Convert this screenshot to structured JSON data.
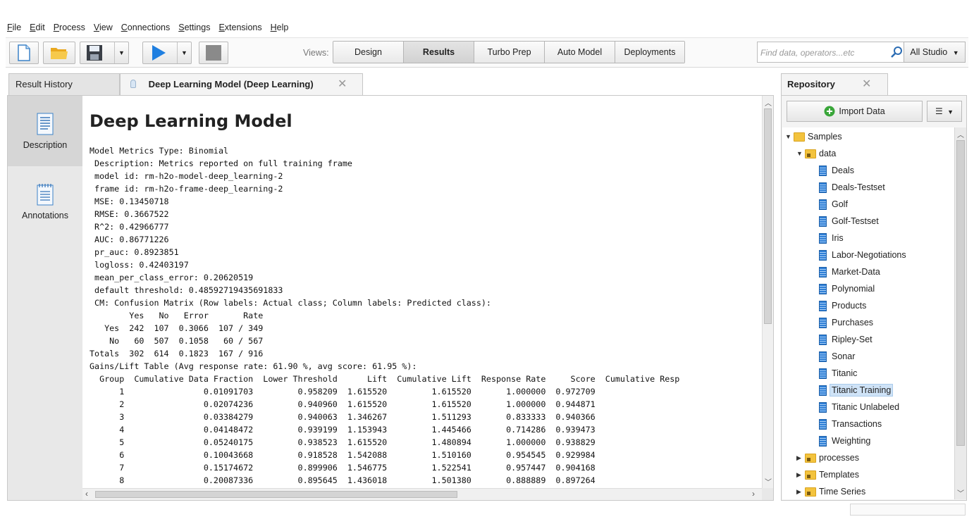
{
  "menu": [
    "File",
    "Edit",
    "Process",
    "View",
    "Connections",
    "Settings",
    "Extensions",
    "Help"
  ],
  "toolbar": {
    "views_label": "Views:",
    "views": [
      {
        "label": "Design",
        "active": false
      },
      {
        "label": "Results",
        "active": true
      },
      {
        "label": "Turbo Prep",
        "active": false
      },
      {
        "label": "Auto Model",
        "active": false
      },
      {
        "label": "Deployments",
        "active": false
      }
    ],
    "search_placeholder": "Find data, operators...etc",
    "studio_label": "All Studio"
  },
  "tabs": {
    "result_history": "Result History",
    "active_tab": "Deep Learning Model (Deep Learning)"
  },
  "side_tabs": {
    "description": "Description",
    "annotations": "Annotations"
  },
  "content": {
    "title": "Deep Learning Model",
    "lines": [
      "Model Metrics Type: Binomial",
      " Description: Metrics reported on full training frame",
      " model id: rm-h2o-model-deep_learning-2",
      " frame id: rm-h2o-frame-deep_learning-2",
      " MSE: 0.13450718",
      " RMSE: 0.3667522",
      " R^2: 0.42966777",
      " AUC: 0.86771226",
      " pr_auc: 0.8923851",
      " logloss: 0.42403197",
      " mean_per_class_error: 0.20620519",
      " default threshold: 0.48592719435691833",
      " CM: Confusion Matrix (Row labels: Actual class; Column labels: Predicted class):",
      "        Yes   No   Error       Rate",
      "   Yes  242  107  0.3066  107 / 349",
      "    No   60  507  0.1058   60 / 567",
      "Totals  302  614  0.1823  167 / 916",
      "Gains/Lift Table (Avg response rate: 61.90 %, avg score: 61.95 %):",
      "  Group  Cumulative Data Fraction  Lower Threshold      Lift  Cumulative Lift  Response Rate     Score  Cumulative Resp",
      "      1                0.01091703         0.958209  1.615520         1.615520       1.000000  0.972709",
      "      2                0.02074236         0.940960  1.615520         1.615520       1.000000  0.944871",
      "      3                0.03384279         0.940063  1.346267         1.511293       0.833333  0.940366",
      "      4                0.04148472         0.939199  1.153943         1.445466       0.714286  0.939473",
      "      5                0.05240175         0.938523  1.615520         1.480894       1.000000  0.938829",
      "      6                0.10043668         0.918528  1.542088         1.510160       0.954545  0.929984",
      "      7                0.15174672         0.899906  1.546775         1.522541       0.957447  0.904168",
      "      8                0.20087336         0.895645  1.436018         1.501380       0.888889  0.897264"
    ]
  },
  "repository": {
    "title": "Repository",
    "import_label": "Import Data",
    "tree": {
      "samples": "Samples",
      "data": "data",
      "datasets": [
        "Deals",
        "Deals-Testset",
        "Golf",
        "Golf-Testset",
        "Iris",
        "Labor-Negotiations",
        "Market-Data",
        "Polynomial",
        "Products",
        "Purchases",
        "Ripley-Set",
        "Sonar",
        "Titanic",
        "Titanic Training",
        "Titanic Unlabeled",
        "Transactions",
        "Weighting"
      ],
      "selected": "Titanic Training",
      "folders": [
        "processes",
        "Templates",
        "Time Series"
      ]
    }
  },
  "colors": {
    "accent_blue": "#2f7fd6",
    "folder_yellow": "#f3c33e",
    "play_blue": "#1f7fe0",
    "selection": "#cfe3f7"
  }
}
